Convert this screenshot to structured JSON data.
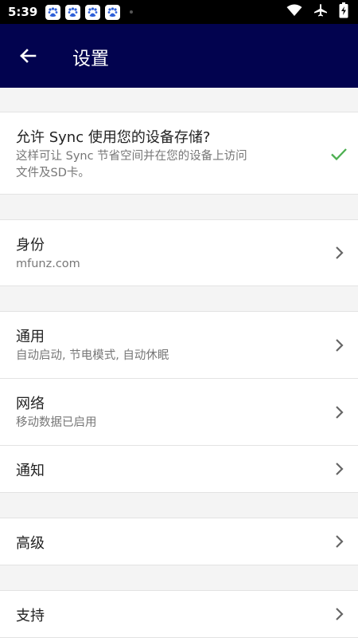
{
  "status_bar": {
    "time": "5:39",
    "notification_icons": [
      "baidu-icon",
      "baidu-icon",
      "baidu-icon",
      "baidu-icon"
    ],
    "right_icons": [
      "wifi-icon",
      "airplane-mode-icon",
      "battery-charging-icon"
    ]
  },
  "app_bar": {
    "title": "设置",
    "back_icon": "arrow-left-icon",
    "background_color": "#02034f"
  },
  "sections": {
    "storage": {
      "title": "允许 Sync 使用您的设备存储?",
      "subtitle_line1": "这样可让 Sync 节省空间并在您的设备上访问",
      "subtitle_line2": "文件及SD卡。",
      "status_icon": "check-icon",
      "check_color": "#4caf50"
    },
    "identity": {
      "title": "身份",
      "subtitle": "mfunz.com"
    },
    "general": {
      "title": "通用",
      "subtitle": "自动启动, 节电模式, 自动休眠"
    },
    "network": {
      "title": "网络",
      "subtitle": "移动数据已启用"
    },
    "notifications": {
      "title": "通知"
    },
    "advanced": {
      "title": "高级"
    },
    "support": {
      "title": "支持"
    }
  }
}
